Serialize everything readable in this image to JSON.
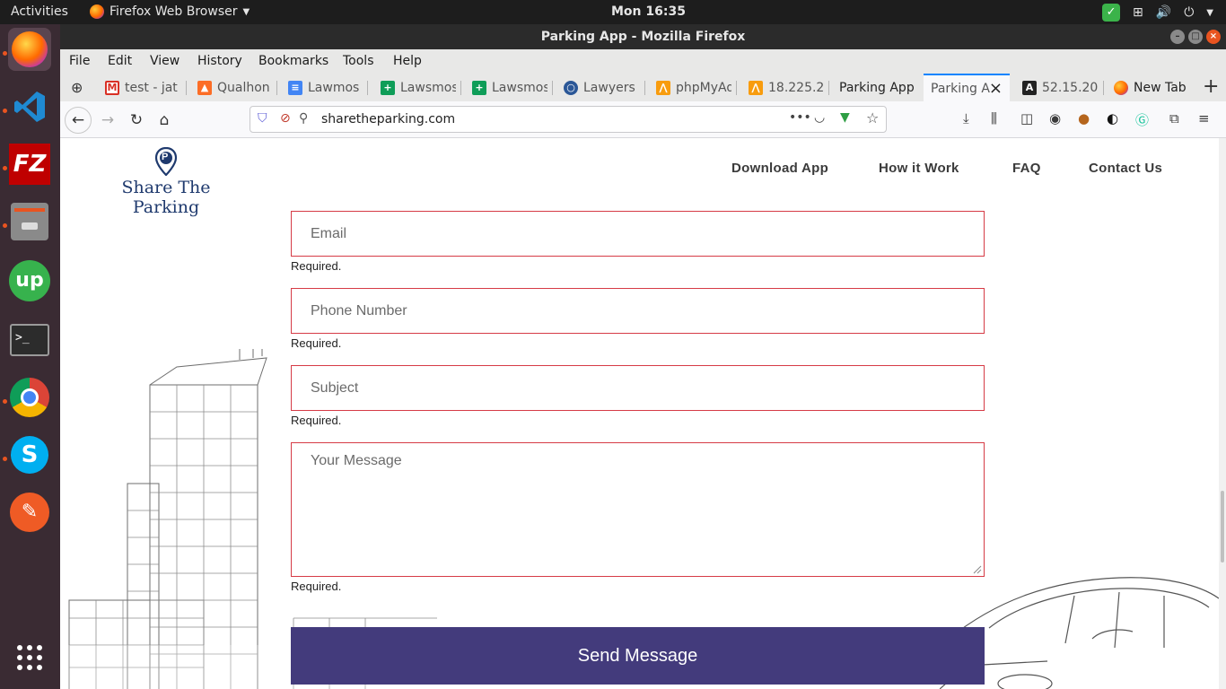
{
  "topbar": {
    "activities": "Activities",
    "app_menu": "Firefox Web Browser",
    "clock": "Mon 16:35"
  },
  "window": {
    "title": "Parking App - Mozilla Firefox"
  },
  "menubar": {
    "items": [
      "File",
      "Edit",
      "View",
      "History",
      "Bookmarks",
      "Tools",
      "Help"
    ]
  },
  "tabs": [
    {
      "label": "test - jat",
      "icon": "gmail-icon",
      "color": "#d93025"
    },
    {
      "label": "Qualhon",
      "icon": "gitlab-icon",
      "color": "#fc6d26"
    },
    {
      "label": "Lawmos",
      "icon": "docs-icon",
      "color": "#4285f4"
    },
    {
      "label": "Lawsmos",
      "icon": "sheets-icon",
      "color": "#0f9d58"
    },
    {
      "label": "Lawsmos",
      "icon": "sheets-icon",
      "color": "#0f9d58"
    },
    {
      "label": "Lawyers",
      "icon": "globe-icon",
      "color": "#2b5797"
    },
    {
      "label": "phpMyAd",
      "icon": "phpmyadmin-icon",
      "color": "#f89c0e"
    },
    {
      "label": "18.225.2",
      "icon": "phpmyadmin-icon",
      "color": "#f89c0e"
    },
    {
      "label": "Parking App",
      "icon": "",
      "color": ""
    },
    {
      "label": "Parking A",
      "icon": "",
      "color": ""
    },
    {
      "label": "52.15.20",
      "icon": "angular-icon",
      "color": "#222222"
    },
    {
      "label": "New Tab",
      "icon": "firefox-icon",
      "color": "#ff7139"
    }
  ],
  "urlbar": {
    "url": "sharetheparking.com"
  },
  "site": {
    "logo_text": "Share The Parking",
    "logo_badge": "P",
    "nav": [
      "Download App",
      "How it Work",
      "FAQ",
      "Contact Us"
    ],
    "form": {
      "email_placeholder": "Email",
      "phone_placeholder": "Phone Number",
      "subject_placeholder": "Subject",
      "message_placeholder": "Your Message",
      "required_text": "Required.",
      "send_label": "Send Message"
    }
  },
  "colors": {
    "accent": "#433b7c",
    "error_border": "#d63b46",
    "logo_blue": "#1f3a6e"
  }
}
